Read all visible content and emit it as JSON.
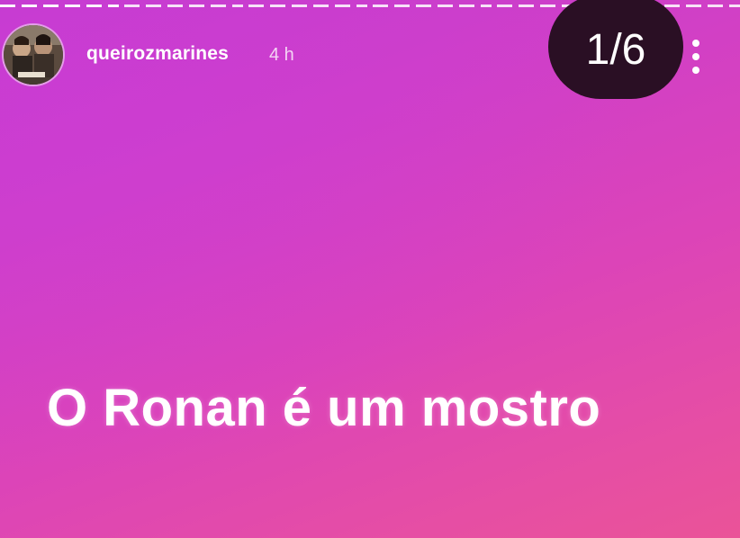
{
  "story": {
    "author": {
      "username": "queirozmarines",
      "avatar_icon": "profile-photo"
    },
    "posted_ago": "4 h",
    "counter": "1/6",
    "current_index": 1,
    "total": 6,
    "caption": "O Ronan é um mostro",
    "more_icon": "vertical-ellipsis-icon",
    "colors": {
      "gradient_start": "#c23ccf",
      "gradient_end": "#ea5398",
      "counter_bg": "#2a0f24",
      "text": "#ffffff"
    }
  }
}
